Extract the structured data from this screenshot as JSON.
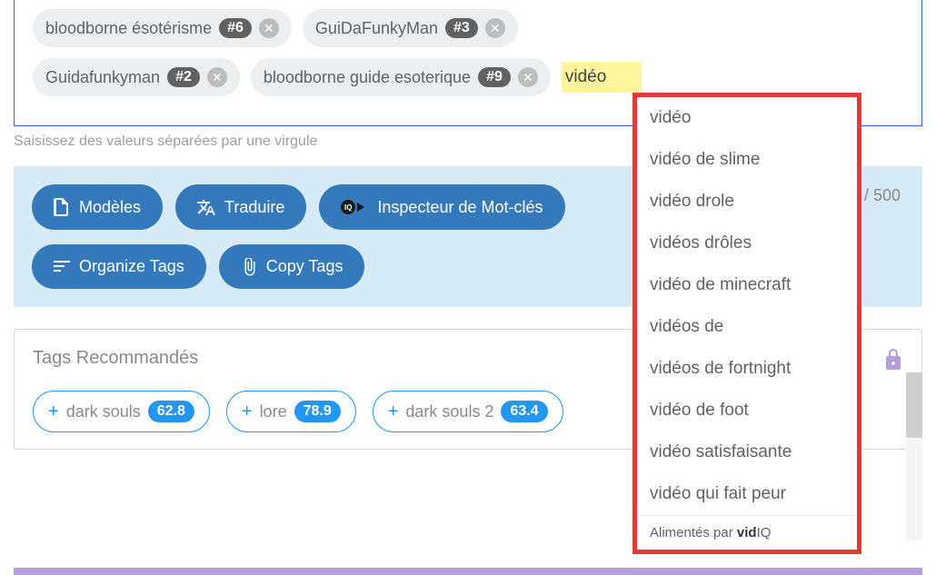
{
  "tags": {
    "row1": [
      {
        "label": "bloodborne ésotérisme",
        "badge": "#6"
      },
      {
        "label": "GuiDaFunkyMan",
        "badge": "#3"
      }
    ],
    "row2": [
      {
        "label": "Guidafunkyman",
        "badge": "#2"
      },
      {
        "label": "bloodborne guide esoterique",
        "badge": "#9"
      }
    ],
    "input_value": "vidéo"
  },
  "helper": "Saisissez des valeurs séparées par une virgule",
  "toolbar": {
    "models": "Modèles",
    "translate": "Traduire",
    "inspector": "Inspecteur de Mot-clés",
    "organize": "Organize Tags",
    "copy": "Copy Tags",
    "count_suffix": " / 500"
  },
  "recommended": {
    "title": "Tags Recommandés",
    "items": [
      {
        "label": "dark souls",
        "score": "62.8"
      },
      {
        "label": "lore",
        "score": "78.9"
      },
      {
        "label": "dark souls 2",
        "score": "63.4"
      }
    ]
  },
  "autocomplete": {
    "items": [
      "vidéo",
      "vidéo de slime",
      "vidéo drole",
      "vidéos drôles",
      "vidéo de minecraft",
      "vidéos de",
      "vidéos de fortnight",
      "vidéo de foot",
      "vidéo satisfaisante",
      "vidéo qui fait peur"
    ],
    "footer_prefix": "Alimentés par ",
    "footer_brand_bold": "vid",
    "footer_brand_rest": "IQ"
  }
}
